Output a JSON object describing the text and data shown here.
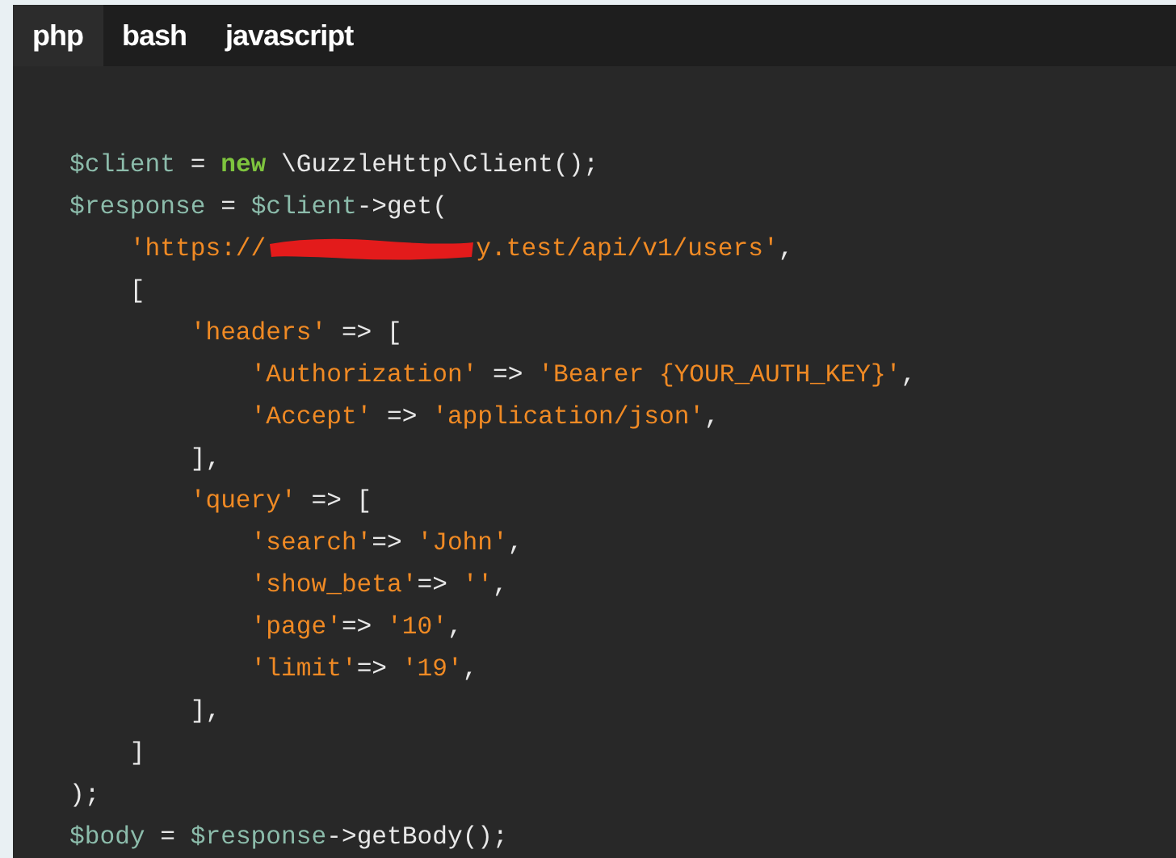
{
  "tabs": [
    {
      "label": "php",
      "selected": true
    },
    {
      "label": "bash",
      "selected": false
    },
    {
      "label": "javascript",
      "selected": false
    }
  ],
  "code_lines": [
    [
      {
        "kind": "variable",
        "text": "$client"
      },
      {
        "kind": "plain",
        "text": " = "
      },
      {
        "kind": "keyword",
        "text": "new"
      },
      {
        "kind": "plain",
        "text": " \\GuzzleHttp\\Client();"
      }
    ],
    [
      {
        "kind": "variable",
        "text": "$response"
      },
      {
        "kind": "plain",
        "text": " = "
      },
      {
        "kind": "variable",
        "text": "$client"
      },
      {
        "kind": "plain",
        "text": "->get("
      }
    ],
    [
      {
        "kind": "string",
        "text": "    'https://"
      },
      {
        "kind": "redaction"
      },
      {
        "kind": "string",
        "text": "y.test/api/v1/users'"
      },
      {
        "kind": "plain",
        "text": ","
      }
    ],
    [
      {
        "kind": "plain",
        "text": "    ["
      }
    ],
    [
      {
        "kind": "string",
        "text": "        'headers'"
      },
      {
        "kind": "plain",
        "text": " => ["
      }
    ],
    [
      {
        "kind": "string",
        "text": "            'Authorization'"
      },
      {
        "kind": "plain",
        "text": " => "
      },
      {
        "kind": "string",
        "text": "'Bearer {YOUR_AUTH_KEY}'"
      },
      {
        "kind": "plain",
        "text": ","
      }
    ],
    [
      {
        "kind": "string",
        "text": "            'Accept'"
      },
      {
        "kind": "plain",
        "text": " => "
      },
      {
        "kind": "string",
        "text": "'application/json'"
      },
      {
        "kind": "plain",
        "text": ","
      }
    ],
    [
      {
        "kind": "plain",
        "text": "        ],"
      }
    ],
    [
      {
        "kind": "string",
        "text": "        'query'"
      },
      {
        "kind": "plain",
        "text": " => ["
      }
    ],
    [
      {
        "kind": "string",
        "text": "            'search'"
      },
      {
        "kind": "plain",
        "text": "=> "
      },
      {
        "kind": "string",
        "text": "'John'"
      },
      {
        "kind": "plain",
        "text": ","
      }
    ],
    [
      {
        "kind": "string",
        "text": "            'show_beta'"
      },
      {
        "kind": "plain",
        "text": "=> "
      },
      {
        "kind": "string",
        "text": "''"
      },
      {
        "kind": "plain",
        "text": ","
      }
    ],
    [
      {
        "kind": "string",
        "text": "            'page'"
      },
      {
        "kind": "plain",
        "text": "=> "
      },
      {
        "kind": "string",
        "text": "'10'"
      },
      {
        "kind": "plain",
        "text": ","
      }
    ],
    [
      {
        "kind": "string",
        "text": "            'limit'"
      },
      {
        "kind": "plain",
        "text": "=> "
      },
      {
        "kind": "string",
        "text": "'19'"
      },
      {
        "kind": "plain",
        "text": ","
      }
    ],
    [
      {
        "kind": "plain",
        "text": "        ],"
      }
    ],
    [
      {
        "kind": "plain",
        "text": "    ]"
      }
    ],
    [
      {
        "kind": "plain",
        "text": ");"
      }
    ],
    [
      {
        "kind": "variable",
        "text": "$body"
      },
      {
        "kind": "plain",
        "text": " = "
      },
      {
        "kind": "variable",
        "text": "$response"
      },
      {
        "kind": "plain",
        "text": "->getBody();"
      }
    ]
  ]
}
